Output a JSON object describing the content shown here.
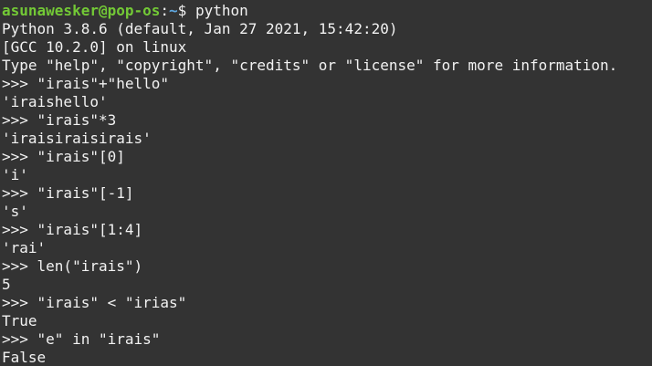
{
  "shell": {
    "user_host": "asunawesker@pop-os",
    "colon": ":",
    "path": "~",
    "prompt_sign": "$ ",
    "command": "python"
  },
  "colors": {
    "background": "#333333",
    "foreground": "#f2f2f2",
    "user_host": "#73c936",
    "path": "#5fa8e0"
  },
  "lines": [
    "Python 3.8.6 (default, Jan 27 2021, 15:42:20)",
    "[GCC 10.2.0] on linux",
    "Type \"help\", \"copyright\", \"credits\" or \"license\" for more information.",
    ">>> \"irais\"+\"hello\"",
    "'iraishello'",
    ">>> \"irais\"*3",
    "'iraisiraisirais'",
    ">>> \"irais\"[0]",
    "'i'",
    ">>> \"irais\"[-1]",
    "'s'",
    ">>> \"irais\"[1:4]",
    "'rai'",
    ">>> len(\"irais\")",
    "5",
    ">>> \"irais\" < \"irias\"",
    "True",
    ">>> \"e\" in \"irais\"",
    "False"
  ]
}
